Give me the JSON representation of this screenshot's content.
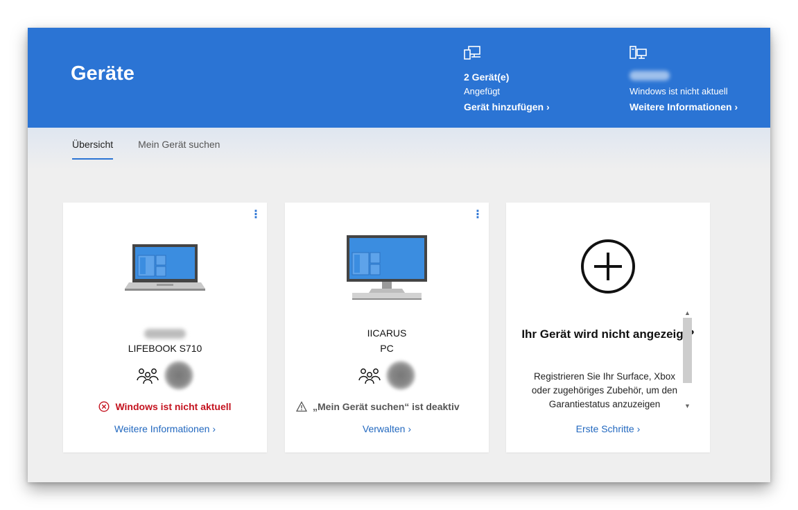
{
  "header": {
    "title": "Geräte",
    "devices_stat": {
      "count": "2 Gerät(e)",
      "label": "Angefügt",
      "link": "Gerät hinzufügen",
      "icon": "devices-icon"
    },
    "pc_stat": {
      "status": "Windows ist nicht aktuell",
      "link": "Weitere Informationen",
      "icon": "pc-icon"
    }
  },
  "tabs": [
    {
      "label": "Übersicht",
      "active": true
    },
    {
      "label": "Mein Gerät suchen",
      "active": false
    }
  ],
  "cards": [
    {
      "model": "LIFEBOOK S710",
      "status": "Windows ist nicht aktuell",
      "link": "Weitere Informationen",
      "status_color": "#c4131f"
    },
    {
      "name": "IICARUS",
      "type": "PC",
      "status": "„Mein Gerät suchen“ ist deaktiv",
      "link": "Verwalten"
    },
    {
      "title": "Ihr Gerät wird nicht angezeigt?",
      "text": "Registrieren Sie Ihr Surface, Xbox oder zugehöriges Zubehör, um den Garantiestatus anzuzeigen",
      "link": "Erste Schritte"
    }
  ],
  "colors": {
    "banner": "#2b74d4",
    "link": "#2268bf",
    "error": "#c4131f"
  }
}
